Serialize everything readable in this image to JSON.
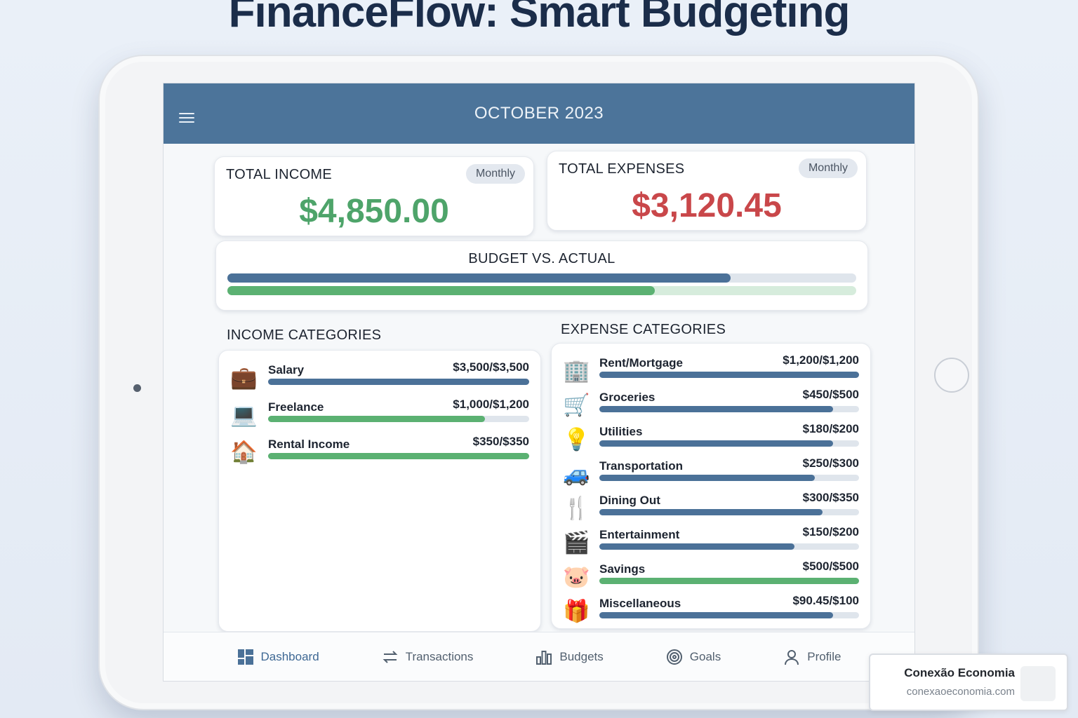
{
  "page_title": "FinanceFlow: Smart Budgeting",
  "header": {
    "month": "OCTOBER 2023",
    "menu_icon": "hamburger-menu-icon"
  },
  "summary": {
    "income": {
      "label": "TOTAL INCOME",
      "period": "Monthly",
      "value": "$4,850.00",
      "color": "#4ea46a"
    },
    "expenses": {
      "label": "TOTAL EXPENSES",
      "period": "Monthly",
      "value": "$3,120.45",
      "color": "#c9474a"
    }
  },
  "budget_vs_actual": {
    "title": "BUDGET VS. ACTUAL",
    "bars": [
      {
        "color": "#4b7198",
        "progress": 0.8
      },
      {
        "color": "#5bb172",
        "progress": 0.68
      }
    ]
  },
  "income_categories": {
    "heading": "INCOME CATEGORIES",
    "items": [
      {
        "name": "Salary",
        "amount": "$3,500/$3,500",
        "icon": "briefcase-icon",
        "glyph": "💼",
        "progress": 1.0,
        "color": "#4b7198"
      },
      {
        "name": "Freelance",
        "amount": "$1,000/$1,200",
        "icon": "laptop-icon",
        "glyph": "💻",
        "progress": 0.83,
        "color": "#5bb172"
      },
      {
        "name": "Rental Income",
        "amount": "$350/$350",
        "icon": "house-icon",
        "glyph": "🏠",
        "progress": 1.0,
        "color": "#5bb172"
      }
    ]
  },
  "expense_categories": {
    "heading": "EXPENSE CATEGORIES",
    "items": [
      {
        "name": "Rent/Mortgage",
        "amount": "$1,200/$1,200",
        "icon": "building-icon",
        "glyph": "🏢",
        "progress": 1.0,
        "color": "#4b7198"
      },
      {
        "name": "Groceries",
        "amount": "$450/$500",
        "icon": "shopping-cart-icon",
        "glyph": "🛒",
        "progress": 0.9,
        "color": "#4b7198"
      },
      {
        "name": "Utilities",
        "amount": "$180/$200",
        "icon": "lightbulb-icon",
        "glyph": "💡",
        "progress": 0.9,
        "color": "#4b7198"
      },
      {
        "name": "Transportation",
        "amount": "$250/$300",
        "icon": "car-icon",
        "glyph": "🚙",
        "progress": 0.83,
        "color": "#4b7198"
      },
      {
        "name": "Dining Out",
        "amount": "$300/$350",
        "icon": "fork-knife-icon",
        "glyph": "🍴",
        "progress": 0.86,
        "color": "#4b7198"
      },
      {
        "name": "Entertainment",
        "amount": "$150/$200",
        "icon": "clapperboard-icon",
        "glyph": "🎬",
        "progress": 0.75,
        "color": "#4b7198"
      },
      {
        "name": "Savings",
        "amount": "$500/$500",
        "icon": "piggy-bank-icon",
        "glyph": "🐷",
        "progress": 1.0,
        "color": "#5bb172"
      },
      {
        "name": "Miscellaneous",
        "amount": "$90.45/$100",
        "icon": "gift-icon",
        "glyph": "🎁",
        "progress": 0.9,
        "color": "#4b7198"
      }
    ]
  },
  "nav": [
    {
      "label": "Dashboard",
      "icon": "dashboard-icon",
      "active": true
    },
    {
      "label": "Transactions",
      "icon": "transfer-arrows-icon",
      "active": false
    },
    {
      "label": "Budgets",
      "icon": "bar-chart-icon",
      "active": false
    },
    {
      "label": "Goals",
      "icon": "target-icon",
      "active": false
    },
    {
      "label": "Profile",
      "icon": "user-icon",
      "active": false
    }
  ],
  "badge": {
    "name": "Conexão Economia",
    "url": "conexaoeconomia.com"
  }
}
